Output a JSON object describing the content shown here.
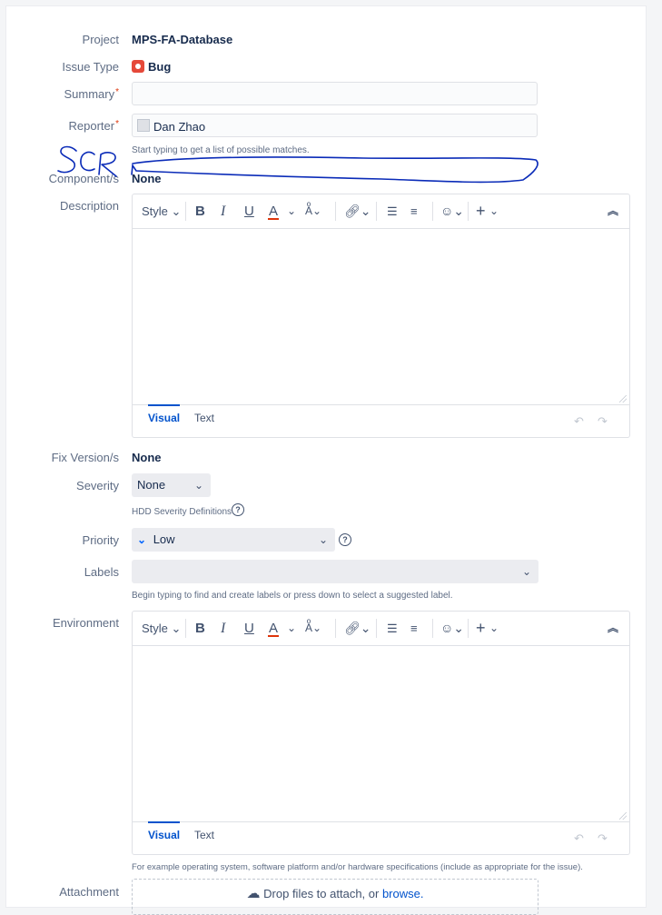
{
  "form": {
    "project": {
      "label": "Project",
      "value": "MPS-FA-Database"
    },
    "issue_type": {
      "label": "Issue Type",
      "value": "Bug"
    },
    "summary": {
      "label": "Summary",
      "required_mark": "*",
      "value": ""
    },
    "reporter": {
      "label": "Reporter",
      "required_mark": "*",
      "value": "Dan Zhao",
      "hint": "Start typing to get a list of possible matches."
    },
    "components": {
      "label": "Component/s",
      "value": "None"
    },
    "description": {
      "label": "Description",
      "value": ""
    },
    "fix_versions": {
      "label": "Fix Version/s",
      "value": "None"
    },
    "severity": {
      "label": "Severity",
      "value": "None",
      "hint": "HDD Severity Definitions"
    },
    "priority": {
      "label": "Priority",
      "value": "Low"
    },
    "labels": {
      "label": "Labels",
      "value": "",
      "hint": "Begin typing to find and create labels or press down to select a suggested label."
    },
    "environment": {
      "label": "Environment",
      "value": "",
      "hint": "For example operating system, software platform and/or hardware specifications (include as appropriate for the issue)."
    },
    "attachment": {
      "label": "Attachment",
      "drop_text": "Drop files to attach, or ",
      "browse_text": "browse."
    }
  },
  "editor": {
    "style_label": "Style",
    "bold": "B",
    "italic": "I",
    "underline": "U",
    "text_color": "A",
    "tab_visual": "Visual",
    "tab_text": "Text"
  },
  "annotation": {
    "handwritten_text": "SCR"
  },
  "colors": {
    "bug": "#e5493a",
    "link": "#0052cc",
    "required": "#de350b",
    "scribble": "#0a2bb8"
  }
}
